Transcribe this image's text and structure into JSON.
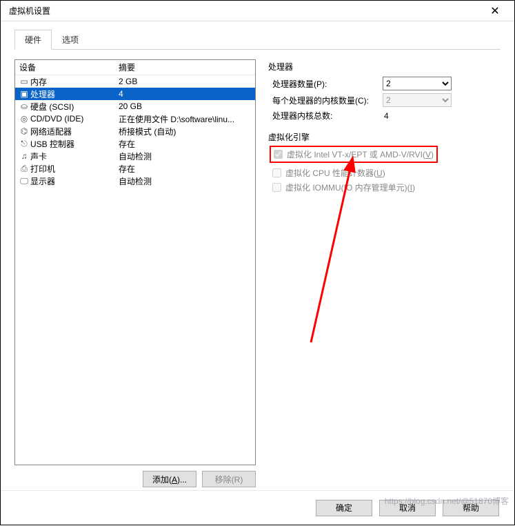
{
  "window": {
    "title": "虚拟机设置",
    "close_glyph": "✕"
  },
  "tabs": {
    "hardware": "硬件",
    "options": "选项"
  },
  "list_header": {
    "device": "设备",
    "summary": "摘要"
  },
  "devices": [
    {
      "icon": "memory-icon",
      "glyph": "▭",
      "name": "内存",
      "summary": "2 GB"
    },
    {
      "icon": "cpu-icon",
      "glyph": "▣",
      "name": "处理器",
      "summary": "4",
      "selected": true
    },
    {
      "icon": "disk-icon",
      "glyph": "⛀",
      "name": "硬盘 (SCSI)",
      "summary": "20 GB"
    },
    {
      "icon": "cd-icon",
      "glyph": "◎",
      "name": "CD/DVD (IDE)",
      "summary": "正在使用文件 D:\\software\\linu..."
    },
    {
      "icon": "nic-icon",
      "glyph": "⌬",
      "name": "网络适配器",
      "summary": "桥接模式 (自动)"
    },
    {
      "icon": "usb-icon",
      "glyph": "⎋",
      "name": "USB 控制器",
      "summary": "存在"
    },
    {
      "icon": "sound-icon",
      "glyph": "♫",
      "name": "声卡",
      "summary": "自动检测"
    },
    {
      "icon": "printer-icon",
      "glyph": "⎙",
      "name": "打印机",
      "summary": "存在"
    },
    {
      "icon": "display-icon",
      "glyph": "🖵",
      "name": "显示器",
      "summary": "自动检测"
    }
  ],
  "left_buttons": {
    "add": "添加(A)...",
    "remove": "移除(R)"
  },
  "cpu_panel": {
    "group1_title": "处理器",
    "proc_count_label": "处理器数量(P):",
    "proc_count_value": "2",
    "cores_per_label": "每个处理器的内核数量(C):",
    "cores_per_value": "2",
    "total_label": "处理器内核总数:",
    "total_value": "4",
    "group2_title": "虚拟化引擎",
    "vt_label_pre": "虚拟化 Intel VT-x/EPT 或 AMD-V/RVI(",
    "vt_label_key": "V",
    "vt_label_post": ")",
    "perf_label_pre": "虚拟化 CPU 性能计数器(",
    "perf_label_key": "U",
    "perf_label_post": ")",
    "iommu_label_pre": "虚拟化 IOMM",
    "iommu_label_mid": "(IO 内存管理单元)(",
    "iommu_label_key": "I",
    "iommu_label_post": ")"
  },
  "bottom": {
    "ok": "确定",
    "cancel": "取消",
    "help": "帮助"
  },
  "watermark": "https://blog.csdn.net/@51870博客"
}
